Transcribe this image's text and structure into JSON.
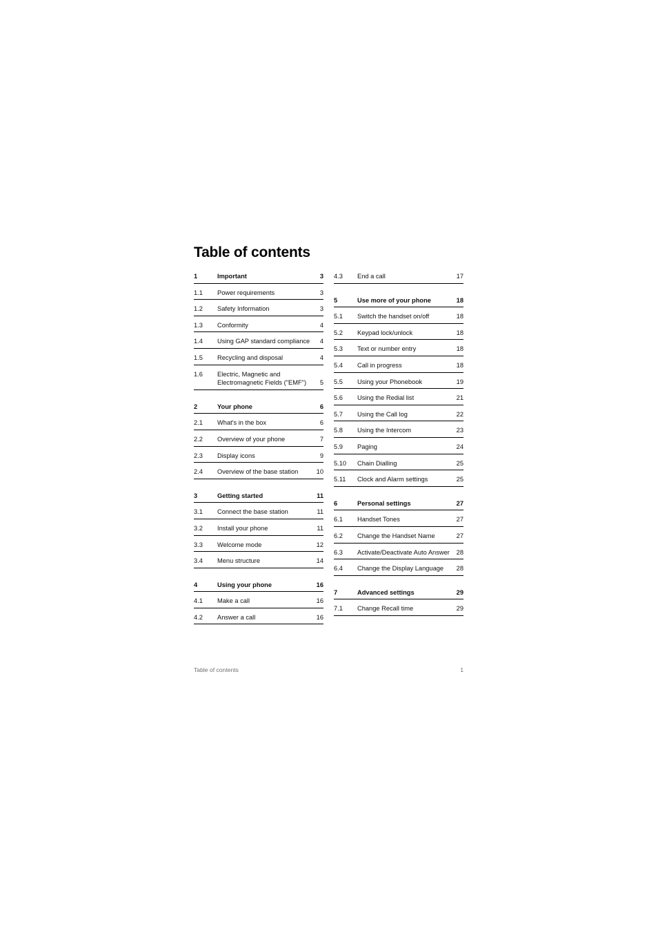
{
  "document": {
    "title": "Table of contents",
    "footer_label": "Table of contents",
    "footer_page": "1"
  },
  "toc": {
    "left_column": [
      {
        "num": "1",
        "label": "Important",
        "page": "3",
        "section": true,
        "group_start": false,
        "two_line": false
      },
      {
        "num": "1.1",
        "label": "Power requirements",
        "page": "3",
        "section": false,
        "group_start": false,
        "two_line": false
      },
      {
        "num": "1.2",
        "label": "Safety Information",
        "page": "3",
        "section": false,
        "group_start": false,
        "two_line": false
      },
      {
        "num": "1.3",
        "label": "Conformity",
        "page": "4",
        "section": false,
        "group_start": false,
        "two_line": false
      },
      {
        "num": "1.4",
        "label": "Using GAP standard compliance",
        "page": "4",
        "section": false,
        "group_start": false,
        "two_line": false
      },
      {
        "num": "1.5",
        "label": "Recycling and disposal",
        "page": "4",
        "section": false,
        "group_start": false,
        "two_line": false
      },
      {
        "num": "1.6",
        "label": "Electric, Magnetic and Electromagnetic Fields (\"EMF\")",
        "page": "5",
        "section": false,
        "group_start": false,
        "two_line": true
      },
      {
        "num": "2",
        "label": "Your phone",
        "page": "6",
        "section": true,
        "group_start": true,
        "two_line": false
      },
      {
        "num": "2.1",
        "label": "What's in the box",
        "page": "6",
        "section": false,
        "group_start": false,
        "two_line": false
      },
      {
        "num": "2.2",
        "label": "Overview of your phone",
        "page": "7",
        "section": false,
        "group_start": false,
        "two_line": false
      },
      {
        "num": "2.3",
        "label": "Display icons",
        "page": "9",
        "section": false,
        "group_start": false,
        "two_line": false
      },
      {
        "num": "2.4",
        "label": "Overview of the base station",
        "page": "10",
        "section": false,
        "group_start": false,
        "two_line": false
      },
      {
        "num": "3",
        "label": "Getting started",
        "page": "11",
        "section": true,
        "group_start": true,
        "two_line": false
      },
      {
        "num": "3.1",
        "label": "Connect the base station",
        "page": "11",
        "section": false,
        "group_start": false,
        "two_line": false
      },
      {
        "num": "3.2",
        "label": "Install your phone",
        "page": "11",
        "section": false,
        "group_start": false,
        "two_line": false
      },
      {
        "num": "3.3",
        "label": "Welcome mode",
        "page": "12",
        "section": false,
        "group_start": false,
        "two_line": false
      },
      {
        "num": "3.4",
        "label": "Menu structure",
        "page": "14",
        "section": false,
        "group_start": false,
        "two_line": false
      },
      {
        "num": "4",
        "label": "Using your phone",
        "page": "16",
        "section": true,
        "group_start": true,
        "two_line": false
      },
      {
        "num": "4.1",
        "label": "Make a call",
        "page": "16",
        "section": false,
        "group_start": false,
        "two_line": false
      },
      {
        "num": "4.2",
        "label": "Answer a call",
        "page": "16",
        "section": false,
        "group_start": false,
        "two_line": false
      }
    ],
    "right_column": [
      {
        "num": "4.3",
        "label": "End a call",
        "page": "17",
        "section": false,
        "group_start": false,
        "two_line": false
      },
      {
        "num": "5",
        "label": "Use more of your phone",
        "page": "18",
        "section": true,
        "group_start": true,
        "two_line": false
      },
      {
        "num": "5.1",
        "label": "Switch the handset on/off",
        "page": "18",
        "section": false,
        "group_start": false,
        "two_line": false
      },
      {
        "num": "5.2",
        "label": "Keypad lock/unlock",
        "page": "18",
        "section": false,
        "group_start": false,
        "two_line": false
      },
      {
        "num": "5.3",
        "label": "Text or number entry",
        "page": "18",
        "section": false,
        "group_start": false,
        "two_line": false
      },
      {
        "num": "5.4",
        "label": "Call in progress",
        "page": "18",
        "section": false,
        "group_start": false,
        "two_line": false
      },
      {
        "num": "5.5",
        "label": "Using your Phonebook",
        "page": "19",
        "section": false,
        "group_start": false,
        "two_line": false
      },
      {
        "num": "5.6",
        "label": "Using the Redial list",
        "page": "21",
        "section": false,
        "group_start": false,
        "two_line": false
      },
      {
        "num": "5.7",
        "label": "Using the Call log",
        "page": "22",
        "section": false,
        "group_start": false,
        "two_line": false
      },
      {
        "num": "5.8",
        "label": "Using the Intercom",
        "page": "23",
        "section": false,
        "group_start": false,
        "two_line": false
      },
      {
        "num": "5.9",
        "label": "Paging",
        "page": "24",
        "section": false,
        "group_start": false,
        "two_line": false
      },
      {
        "num": "5.10",
        "label": "Chain Dialling",
        "page": "25",
        "section": false,
        "group_start": false,
        "two_line": false
      },
      {
        "num": "5.11",
        "label": "Clock and Alarm settings",
        "page": "25",
        "section": false,
        "group_start": false,
        "two_line": false
      },
      {
        "num": "6",
        "label": "Personal settings",
        "page": "27",
        "section": true,
        "group_start": true,
        "two_line": false
      },
      {
        "num": "6.1",
        "label": "Handset Tones",
        "page": "27",
        "section": false,
        "group_start": false,
        "two_line": false
      },
      {
        "num": "6.2",
        "label": "Change the Handset Name",
        "page": "27",
        "section": false,
        "group_start": false,
        "two_line": false
      },
      {
        "num": "6.3",
        "label": "Activate/Deactivate Auto Answer",
        "page": "28",
        "section": false,
        "group_start": false,
        "two_line": true
      },
      {
        "num": "6.4",
        "label": "Change the Display Language",
        "page": "28",
        "section": false,
        "group_start": false,
        "two_line": false
      },
      {
        "num": "7",
        "label": "Advanced settings",
        "page": "29",
        "section": true,
        "group_start": true,
        "two_line": false
      },
      {
        "num": "7.1",
        "label": "Change Recall time",
        "page": "29",
        "section": false,
        "group_start": false,
        "two_line": false
      }
    ]
  }
}
